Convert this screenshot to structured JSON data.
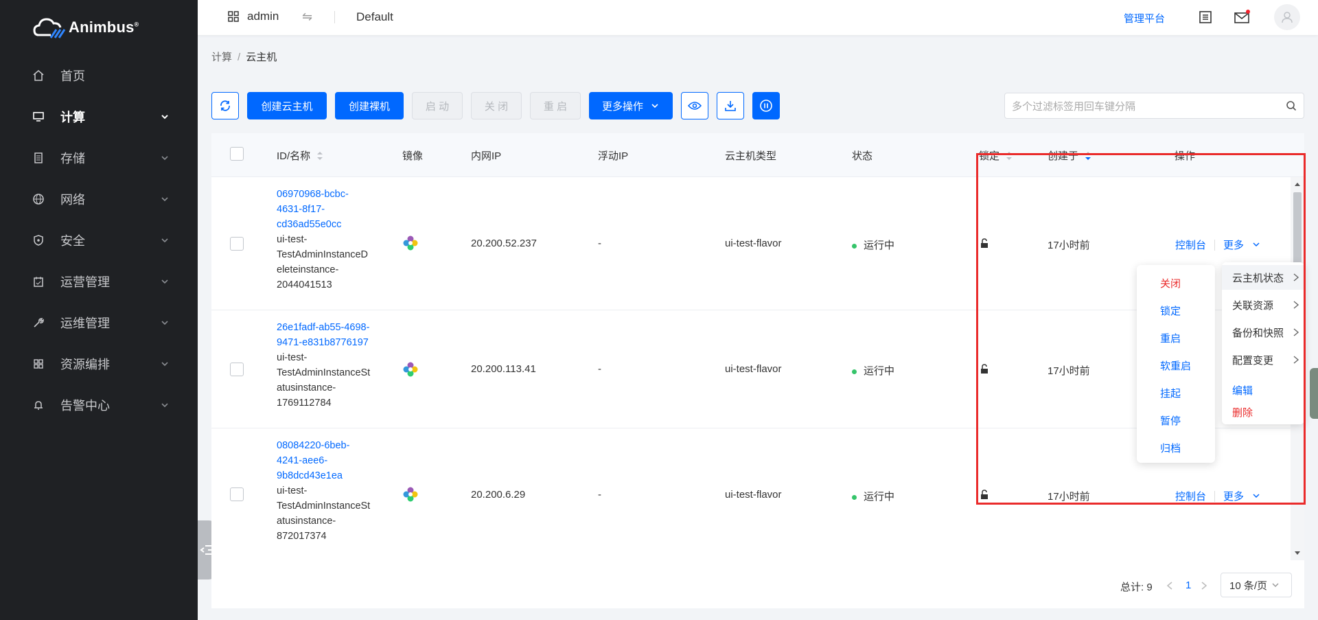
{
  "brand": {
    "name": "Animbus",
    "mark": "®"
  },
  "nav": [
    {
      "label": "首页",
      "icon": "home-icon",
      "active": false,
      "chevron": false
    },
    {
      "label": "计算",
      "icon": "monitor-icon",
      "active": true,
      "chevron": true
    },
    {
      "label": "存储",
      "icon": "storage-icon",
      "active": false,
      "chevron": true
    },
    {
      "label": "网络",
      "icon": "globe-icon",
      "active": false,
      "chevron": true
    },
    {
      "label": "安全",
      "icon": "shield-icon",
      "active": false,
      "chevron": true
    },
    {
      "label": "运营管理",
      "icon": "calendar-icon",
      "active": false,
      "chevron": true
    },
    {
      "label": "运维管理",
      "icon": "wrench-icon",
      "active": false,
      "chevron": true
    },
    {
      "label": "资源编排",
      "icon": "grid-icon",
      "active": false,
      "chevron": true
    },
    {
      "label": "告警中心",
      "icon": "bell-icon",
      "active": false,
      "chevron": true
    }
  ],
  "header": {
    "project": "admin",
    "domain": "Default",
    "admin_link": "管理平台"
  },
  "breadcrumb": {
    "parent": "计算",
    "sep": "/",
    "current": "云主机"
  },
  "toolbar": {
    "create_vm": "创建云主机",
    "create_bm": "创建裸机",
    "start": "启 动",
    "stop": "关 闭",
    "restart": "重 启",
    "more_ops": "更多操作"
  },
  "search": {
    "placeholder": "多个过滤标签用回车键分隔"
  },
  "table": {
    "columns": {
      "id_name": "ID/名称",
      "image": "镜像",
      "private_ip": "内网IP",
      "floating_ip": "浮动IP",
      "flavor": "云主机类型",
      "status": "状态",
      "locked": "锁定",
      "created": "创建于",
      "actions": "操作"
    },
    "rows": [
      {
        "id_lines": [
          "06970968-bcbc-",
          "4631-8f17-",
          "cd36ad55e0cc"
        ],
        "name_lines": [
          "ui-test-",
          "TestAdminInstanceD",
          "eleteinstance-",
          "2044041513"
        ],
        "private_ip": "20.200.52.237",
        "floating_ip": "-",
        "flavor": "ui-test-flavor",
        "status": "运行中",
        "created": "17小时前",
        "console": "控制台",
        "more": "更多"
      },
      {
        "id_lines": [
          "26e1fadf-ab55-4698-",
          "9471-e831b8776197"
        ],
        "name_lines": [
          "ui-test-",
          "TestAdminInstanceSt",
          "atusinstance-",
          "1769112784"
        ],
        "private_ip": "20.200.113.41",
        "floating_ip": "-",
        "flavor": "ui-test-flavor",
        "status": "运行中",
        "created": "17小时前",
        "console": "控制台",
        "more": "更多"
      },
      {
        "id_lines": [
          "08084220-6beb-",
          "4241-aee6-",
          "9b8dcd43e1ea"
        ],
        "name_lines": [
          "ui-test-",
          "TestAdminInstanceSt",
          "atusinstance-",
          "872017374"
        ],
        "private_ip": "20.200.6.29",
        "floating_ip": "-",
        "flavor": "ui-test-flavor",
        "status": "运行中",
        "created": "17小时前",
        "console": "控制台",
        "more": "更多"
      }
    ]
  },
  "pager": {
    "total_label": "总计:",
    "total": "9",
    "page": "1",
    "size": "10 条/页"
  },
  "more_menu": {
    "items": [
      "云主机状态",
      "关联资源",
      "备份和快照",
      "配置变更"
    ],
    "edit": "编辑",
    "delete": "删除"
  },
  "status_submenu": {
    "items": [
      "关闭",
      "锁定",
      "重启",
      "软重启",
      "挂起",
      "暂停",
      "归档"
    ]
  },
  "colors": {
    "primary": "#0068ff",
    "sidebar": "#1f2124",
    "danger": "#ea2b2b",
    "running": "#35c46a"
  }
}
